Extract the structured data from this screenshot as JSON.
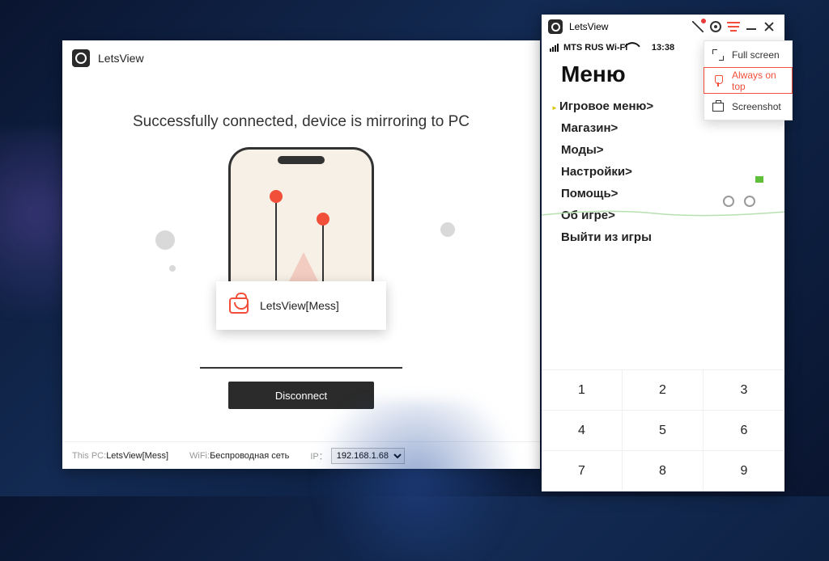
{
  "main_window": {
    "title": "LetsView",
    "success_message": "Successfully connected, device is mirroring to PC",
    "disconnect": "Disconnect",
    "popup_device": "LetsView[Mess]",
    "footer": {
      "pc_label": "This PC:",
      "pc_value": "LetsView[Mess]",
      "wifi_label": "WiFi:",
      "wifi_value": "Беспроводная сеть",
      "ip_label": "IP：",
      "ip_value": "192.168.1.68"
    }
  },
  "mirror_window": {
    "title": "LetsView",
    "status_carrier": "MTS RUS Wi-Fi",
    "clock": "13:38",
    "menu_header": "Меню",
    "menu_items": [
      "Игровое меню>",
      "Магазин>",
      "Моды>",
      "Настройки>",
      "Помощь>",
      "Об игре>",
      "Выйти из игры"
    ]
  },
  "ctx_menu": {
    "fullscreen": "Full screen",
    "always_on_top": "Always on top",
    "screenshot": "Screenshot"
  },
  "keypad": [
    "1",
    "2",
    "3",
    "4",
    "5",
    "6",
    "7",
    "8",
    "9"
  ]
}
